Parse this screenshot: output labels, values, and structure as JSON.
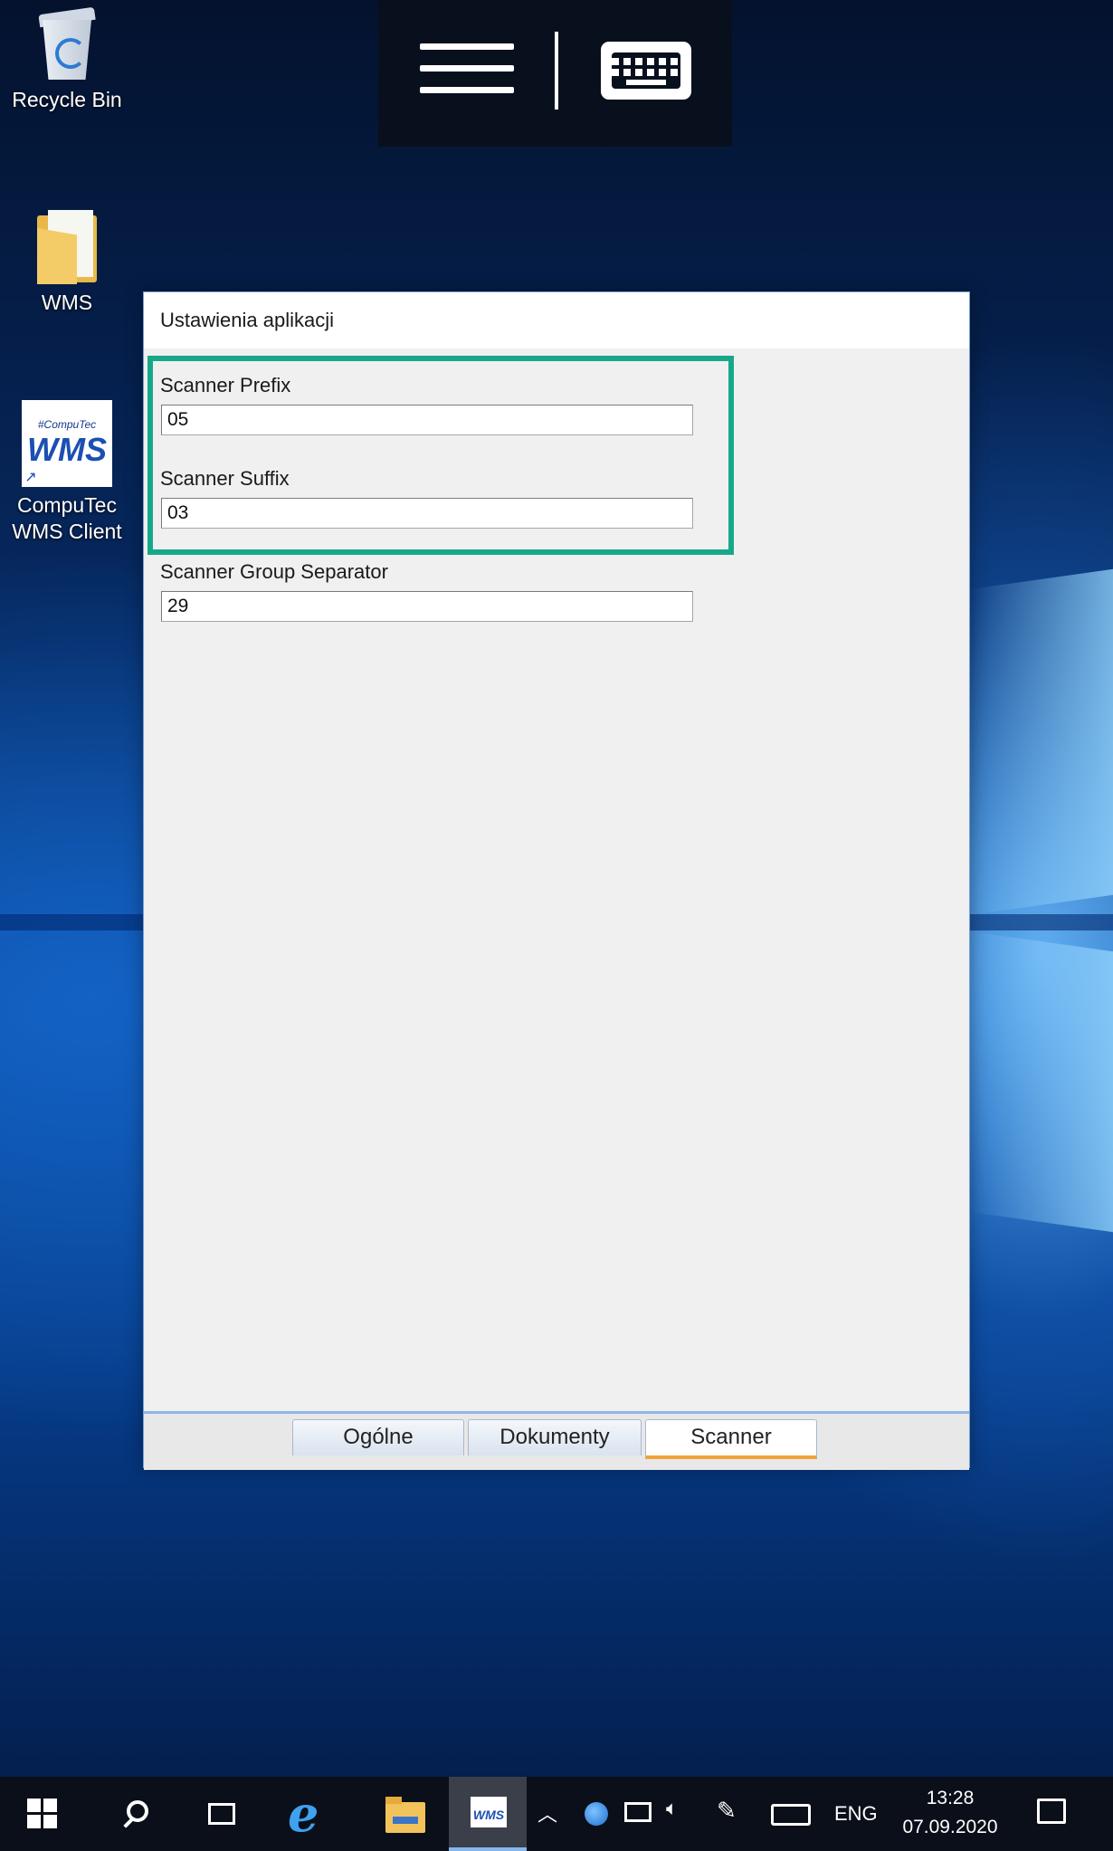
{
  "desktop": {
    "icons": [
      {
        "label": "Recycle Bin"
      },
      {
        "label": "WMS"
      },
      {
        "label_line1": "CompuTec",
        "label_line2": "WMS Client",
        "tile_small": "#CompuTec",
        "tile_big": "WMS"
      }
    ]
  },
  "dialog": {
    "title": "Ustawienia aplikacji",
    "fields": [
      {
        "label": "Scanner Prefix",
        "value": "05"
      },
      {
        "label": "Scanner Suffix",
        "value": "03"
      },
      {
        "label": "Scanner Group Separator",
        "value": "29"
      }
    ],
    "tabs": [
      {
        "label": "Ogólne"
      },
      {
        "label": "Dokumenty"
      },
      {
        "label": "Scanner"
      }
    ],
    "active_tab": "Scanner",
    "highlight_color": "#17a88a"
  },
  "taskbar": {
    "wms_icon_text": "WMS",
    "language": "ENG",
    "time": "13:28",
    "date": "07.09.2020"
  }
}
